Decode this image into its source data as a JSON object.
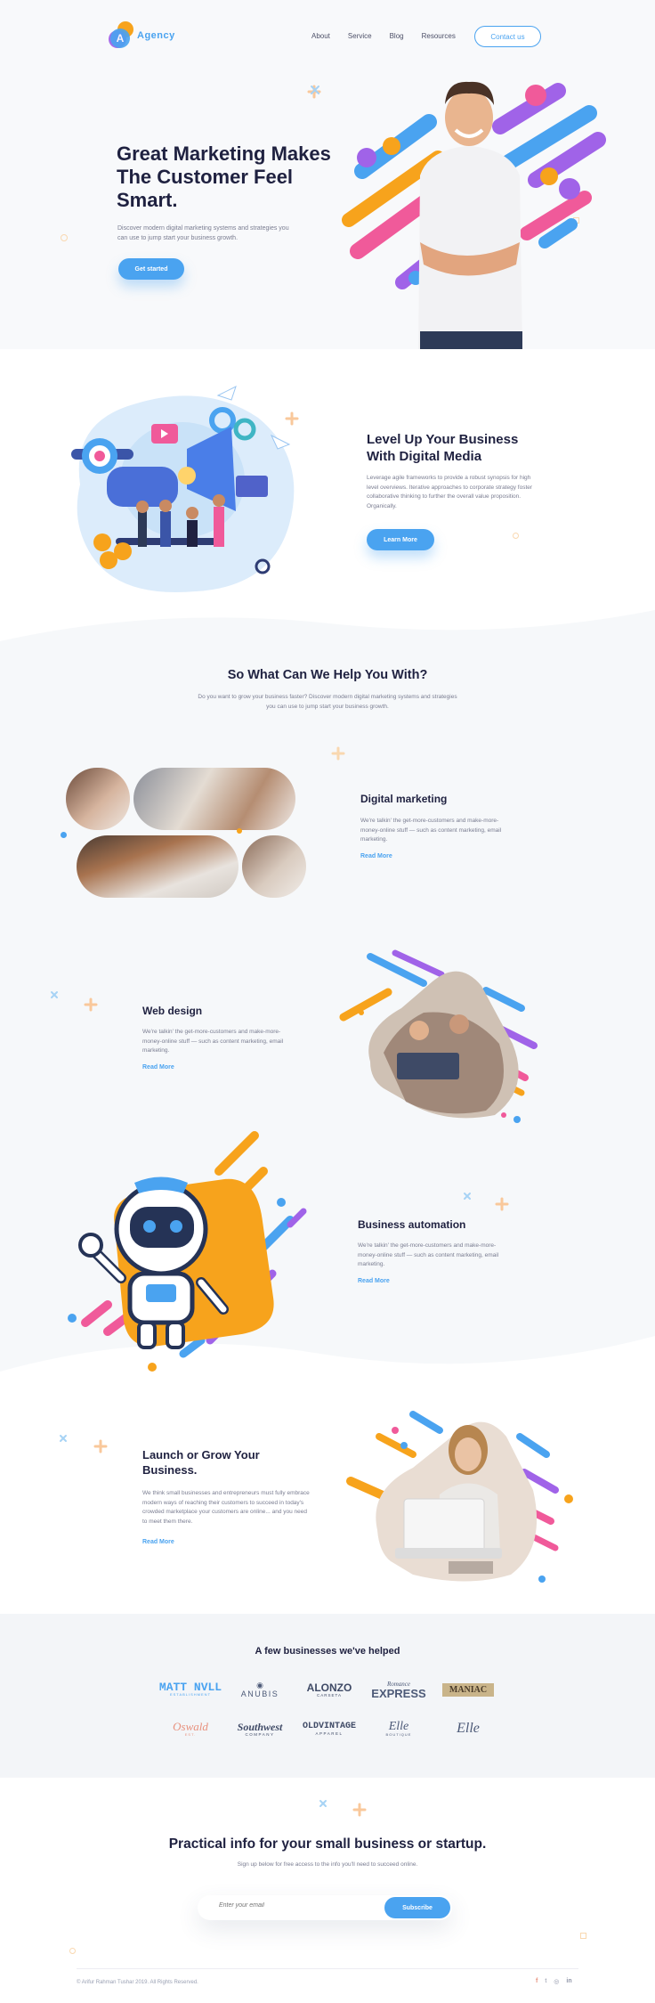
{
  "nav": {
    "logo_letter": "A",
    "logo_text": "Agency",
    "items": [
      {
        "label": "About"
      },
      {
        "label": "Service"
      },
      {
        "label": "Blog"
      },
      {
        "label": "Resources"
      }
    ],
    "contact_label": "Contact us"
  },
  "hero": {
    "title": "Great Marketing Makes The Customer Feel Smart.",
    "subtitle": "Discover modern digital marketing systems and strategies you can use to jump start your business growth.",
    "cta": "Get started"
  },
  "digital_media": {
    "title": "Level Up Your Business With Digital Media",
    "body": "Leverage agile frameworks to provide a robust synopsis for high level overviews. Iterative approaches to corporate strategy foster collaborative thinking to further the overall value proposition. Organically.",
    "cta": "Learn More"
  },
  "services": {
    "title": "So What Can We Help You With?",
    "subtitle": "Do you want to grow your business faster? Discover modern digital marketing systems and strategies you can use to jump start your business growth.",
    "items": [
      {
        "title": "Digital marketing",
        "body": "We're talkin' the get-more-customers and make-more-money-online stuff — such as content marketing, email marketing.",
        "link": "Read More"
      },
      {
        "title": "Web design",
        "body": "We're talkin' the get-more-customers and make-more-money-online stuff — such as content marketing, email marketing.",
        "link": "Read More"
      },
      {
        "title": "Business automation",
        "body": "We're talkin' the get-more-customers and make-more-money-online stuff — such as content marketing, email marketing.",
        "link": "Read More"
      },
      {
        "title": "Launch or Grow Your Business.",
        "body": "We think small businesses and entrepreneurs must fully embrace modern ways of reaching their customers to succeed in today's crowded marketplace your customers are online... and you need to meet them there.",
        "link": "Read More"
      }
    ]
  },
  "clients": {
    "title": "A few businesses we've helped",
    "brands": [
      {
        "name": "MATT NVLL",
        "tag": "ESTABLISHMENT"
      },
      {
        "name": "ANUBIS",
        "tag": ""
      },
      {
        "name": "ALONZO",
        "tag": "CARSETA"
      },
      {
        "name": "EXPRESS",
        "tag": "Romance"
      },
      {
        "name": "MANIAC",
        "tag": ""
      },
      {
        "name": "Oswald",
        "tag": "EST."
      },
      {
        "name": "Southwest",
        "tag": "COMPANY"
      },
      {
        "name": "OLDVINTAGE",
        "tag": "APPAREL"
      },
      {
        "name": "Elle",
        "tag": "BOUTIQUE"
      },
      {
        "name": "Elle",
        "tag": ""
      }
    ]
  },
  "newsletter": {
    "title": "Practical info for your small business or startup.",
    "subtitle": "Sign up below for free access to the info you'll need to succeed online.",
    "placeholder": "Enter your email",
    "cta": "Subscribe"
  },
  "footer": {
    "copyright": "© Arifur Rahman Tushar 2019. All Rights Reserved.",
    "social": [
      "f",
      "t",
      "◎",
      "in"
    ]
  },
  "colors": {
    "accent": "#4aa3f0",
    "purple": "#a063e8",
    "orange": "#f7a31c",
    "pink": "#f05a9a"
  }
}
